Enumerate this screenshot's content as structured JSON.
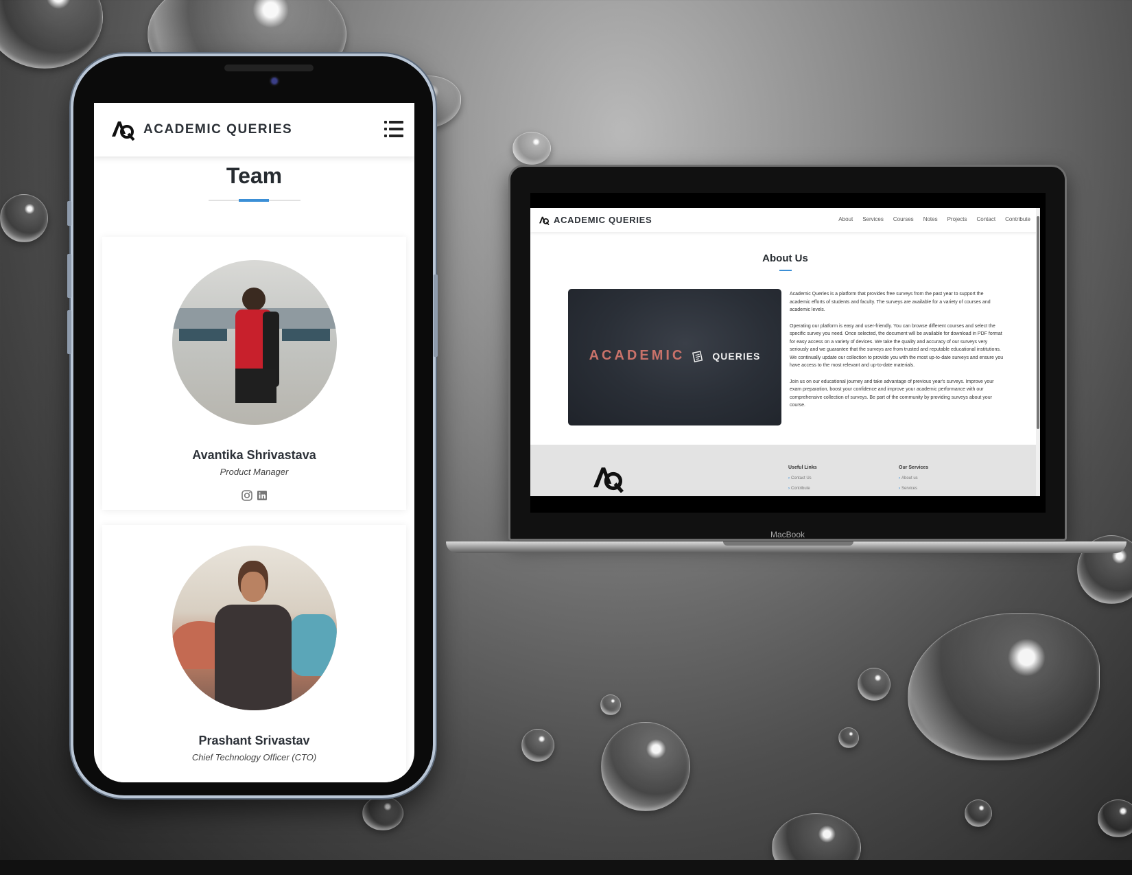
{
  "mobile": {
    "brand": "ACADEMIC QUERIES",
    "page_title": "Team",
    "members": [
      {
        "name": "Avantika Shrivastava",
        "role": "Product Manager"
      },
      {
        "name": "Prashant Srivastav",
        "role": "Chief Technology Officer (CTO)"
      }
    ]
  },
  "desktop": {
    "brand": "ACADEMIC QUERIES",
    "nav": [
      "About",
      "Services",
      "Courses",
      "Notes",
      "Projects",
      "Contact",
      "Contribute"
    ],
    "section_title": "About Us",
    "banner": {
      "left": "ACADEMIC",
      "right": "QUERIES"
    },
    "paragraphs": [
      "Academic Queries is a platform that provides free surveys from the past year to support the academic efforts of students and faculty. The surveys are available for a variety of courses and academic levels.",
      "Operating our platform is easy and user-friendly. You can browse different courses and select the specific survey you need. Once selected, the document will be available for download in PDF format for easy access on a variety of devices. We take the quality and accuracy of our surveys very seriously and we guarantee that the surveys are from trusted and reputable educational institutions. We continually update our collection to provide you with the most up-to-date surveys and ensure you have access to the most relevant and up-to-date materials.",
      "Join us on our educational journey and take advantage of previous year's surveys. Improve your exam preparation, boost your confidence and improve your academic performance with our comprehensive collection of surveys. Be part of the community by providing surveys about your course."
    ],
    "footer": {
      "useful_links": {
        "title": "Useful Links",
        "links": [
          "Contact Us",
          "Contribute"
        ]
      },
      "our_services": {
        "title": "Our Services",
        "links": [
          "About us",
          "Services"
        ]
      }
    }
  },
  "device_label": "MacBook",
  "colors": {
    "accent": "#3b8fd6",
    "banner_accent": "#c9726a",
    "text_dark": "#2b3036"
  },
  "icons": [
    "aq-logo-icon",
    "hamburger-menu-icon",
    "instagram-icon",
    "linkedin-icon",
    "chevron-right-icon",
    "queries-paper-icon"
  ]
}
